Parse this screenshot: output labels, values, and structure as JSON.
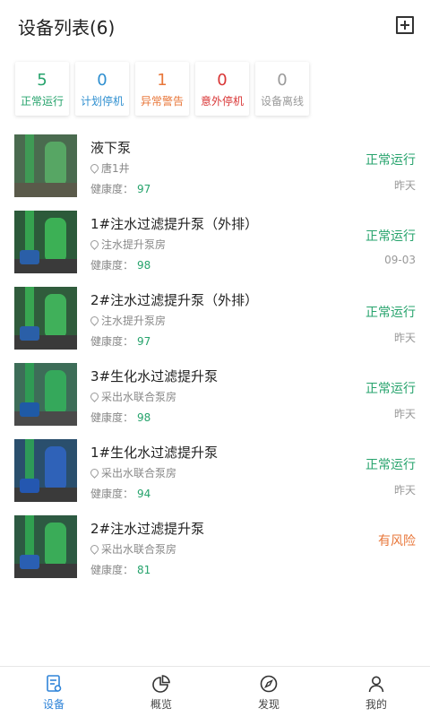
{
  "header": {
    "title": "设备列表(6)"
  },
  "stats": [
    {
      "count": "5",
      "label": "正常运行",
      "color": "#26a36c"
    },
    {
      "count": "0",
      "label": "计划停机",
      "color": "#2f8fd0"
    },
    {
      "count": "1",
      "label": "异常警告",
      "color": "#e8773a"
    },
    {
      "count": "0",
      "label": "意外停机",
      "color": "#d93636"
    },
    {
      "count": "0",
      "label": "设备离线",
      "color": "#9a9a9a"
    }
  ],
  "health_label": "健康度：",
  "devices": [
    {
      "name": "液下泵",
      "location": "唐1井",
      "health": "97",
      "status": "正常运行",
      "status_color": "#26a36c",
      "date": "昨天"
    },
    {
      "name": "1#注水过滤提升泵（外排）",
      "location": "注水提升泵房",
      "health": "98",
      "status": "正常运行",
      "status_color": "#26a36c",
      "date": "09-03"
    },
    {
      "name": "2#注水过滤提升泵（外排）",
      "location": "注水提升泵房",
      "health": "97",
      "status": "正常运行",
      "status_color": "#26a36c",
      "date": "昨天"
    },
    {
      "name": "3#生化水过滤提升泵",
      "location": "采出水联合泵房",
      "health": "98",
      "status": "正常运行",
      "status_color": "#26a36c",
      "date": "昨天"
    },
    {
      "name": "1#生化水过滤提升泵",
      "location": "采出水联合泵房",
      "health": "94",
      "status": "正常运行",
      "status_color": "#26a36c",
      "date": "昨天"
    },
    {
      "name": "2#注水过滤提升泵",
      "location": "采出水联合泵房",
      "health": "81",
      "status": "有风险",
      "status_color": "#e8773a",
      "date": ""
    }
  ],
  "tabs": [
    {
      "label": "设备",
      "icon": "device-list-icon"
    },
    {
      "label": "概览",
      "icon": "pie-chart-icon"
    },
    {
      "label": "发现",
      "icon": "compass-icon"
    },
    {
      "label": "我的",
      "icon": "user-icon"
    }
  ],
  "colors": {
    "accent": "#2f84d8",
    "healthy": "#26a36c",
    "warning": "#e8773a"
  }
}
